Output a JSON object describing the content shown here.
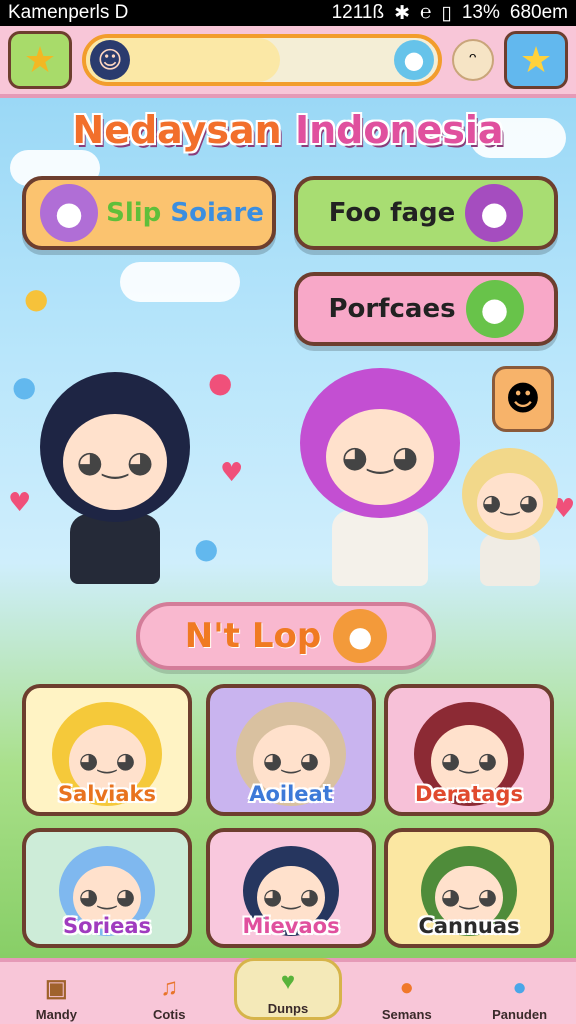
{
  "status_bar": {
    "carrier": "Kamenperls D",
    "time": "1211ß",
    "battery": "13%",
    "extra": "680em"
  },
  "top_bar": {
    "progress": 0.55,
    "left_icon": "star-face-icon",
    "right_icon": "star-icon"
  },
  "title": {
    "part1": "Nedaysan",
    "part2": "Indonesia"
  },
  "menu": {
    "shop": {
      "a": "Slip",
      "b": "Soiare"
    },
    "food": "Foo fage",
    "profile": "Porfcaes"
  },
  "action": {
    "label": "Lop",
    "prefix": "N't"
  },
  "characters": [
    {
      "name": "Salviaks",
      "color": "#f5c93a",
      "bg": "#fff3c4",
      "label_color": "#e8731f"
    },
    {
      "name": "Aoileat",
      "color": "#d9c1a0",
      "bg": "#c9b4ef",
      "label_color": "#3d7ad8"
    },
    {
      "name": "Deratags",
      "color": "#8c2a34",
      "bg": "#f7c1d8",
      "label_color": "#e04a2e"
    },
    {
      "name": "Sorieas",
      "color": "#7fb8ef",
      "bg": "#cdecd8",
      "label_color": "#a03bbf"
    },
    {
      "name": "Mievaos",
      "color": "#26365f",
      "bg": "#f9c8dd",
      "label_color": "#e0509e"
    },
    {
      "name": "Cannuas",
      "color": "#4f8c3a",
      "bg": "#fbe7a2",
      "label_color": "#2b2b2b"
    }
  ],
  "bottom_nav": [
    {
      "label": "Mandy",
      "icon": "chest-icon"
    },
    {
      "label": "Cotis",
      "icon": "bell-icon"
    },
    {
      "label": "Dunps",
      "icon": "heart-icon",
      "active": true
    },
    {
      "label": "Semans",
      "icon": "bear-icon"
    },
    {
      "label": "Panuden",
      "icon": "pet-icon"
    }
  ]
}
